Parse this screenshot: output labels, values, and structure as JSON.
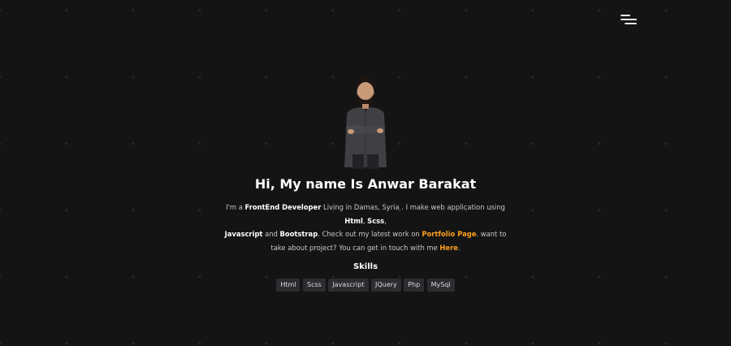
{
  "header": {
    "menu_icon": "hamburger-menu-icon"
  },
  "hero": {
    "avatar_icon": "profile-photo",
    "title": "Hi, My name Is Anwar Barakat",
    "intro": {
      "p1": "I'm a ",
      "role": "FrontEnd Developer",
      "p2": " Living in Damas, Syria . I make web application using ",
      "html": "Html",
      "p3": ", ",
      "scss": "Scss",
      "p4": ", ",
      "javascript": "Javascript",
      "p5": " and ",
      "bootstrap": "Bootstrap",
      "p6": ". Check out my latest work on ",
      "portfolio_link": "Portfolio Page",
      "p7": ". want to take about project? You can get in touch with me ",
      "contact_link": "Here",
      "p8": "."
    }
  },
  "skills": {
    "title": "Skills",
    "items": [
      "Html",
      "Scss",
      "Javascript",
      "JQuery",
      "Php",
      "MySql"
    ]
  },
  "colors": {
    "background": "#141414",
    "accent": "#ff9f1c",
    "badge_bg": "#2d2d31"
  }
}
